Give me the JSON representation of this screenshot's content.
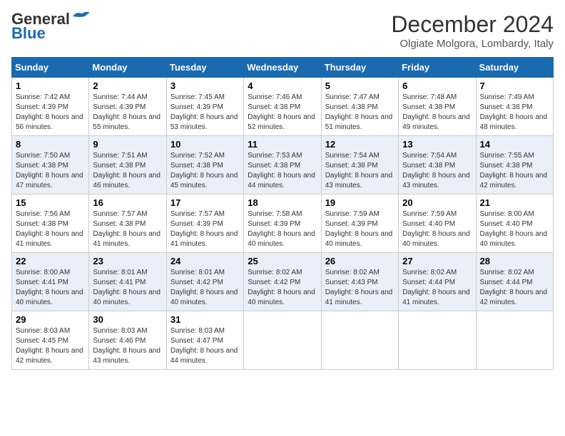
{
  "header": {
    "logo_line1": "General",
    "logo_line2": "Blue",
    "month_title": "December 2024",
    "location": "Olgiate Molgora, Lombardy, Italy"
  },
  "weekdays": [
    "Sunday",
    "Monday",
    "Tuesday",
    "Wednesday",
    "Thursday",
    "Friday",
    "Saturday"
  ],
  "weeks": [
    [
      {
        "day": "1",
        "sunrise": "7:42 AM",
        "sunset": "4:39 PM",
        "daylight": "8 hours and 56 minutes."
      },
      {
        "day": "2",
        "sunrise": "7:44 AM",
        "sunset": "4:39 PM",
        "daylight": "8 hours and 55 minutes."
      },
      {
        "day": "3",
        "sunrise": "7:45 AM",
        "sunset": "4:39 PM",
        "daylight": "8 hours and 53 minutes."
      },
      {
        "day": "4",
        "sunrise": "7:46 AM",
        "sunset": "4:38 PM",
        "daylight": "8 hours and 52 minutes."
      },
      {
        "day": "5",
        "sunrise": "7:47 AM",
        "sunset": "4:38 PM",
        "daylight": "8 hours and 51 minutes."
      },
      {
        "day": "6",
        "sunrise": "7:48 AM",
        "sunset": "4:38 PM",
        "daylight": "8 hours and 49 minutes."
      },
      {
        "day": "7",
        "sunrise": "7:49 AM",
        "sunset": "4:38 PM",
        "daylight": "8 hours and 48 minutes."
      }
    ],
    [
      {
        "day": "8",
        "sunrise": "7:50 AM",
        "sunset": "4:38 PM",
        "daylight": "8 hours and 47 minutes."
      },
      {
        "day": "9",
        "sunrise": "7:51 AM",
        "sunset": "4:38 PM",
        "daylight": "8 hours and 46 minutes."
      },
      {
        "day": "10",
        "sunrise": "7:52 AM",
        "sunset": "4:38 PM",
        "daylight": "8 hours and 45 minutes."
      },
      {
        "day": "11",
        "sunrise": "7:53 AM",
        "sunset": "4:38 PM",
        "daylight": "8 hours and 44 minutes."
      },
      {
        "day": "12",
        "sunrise": "7:54 AM",
        "sunset": "4:38 PM",
        "daylight": "8 hours and 43 minutes."
      },
      {
        "day": "13",
        "sunrise": "7:54 AM",
        "sunset": "4:38 PM",
        "daylight": "8 hours and 43 minutes."
      },
      {
        "day": "14",
        "sunrise": "7:55 AM",
        "sunset": "4:38 PM",
        "daylight": "8 hours and 42 minutes."
      }
    ],
    [
      {
        "day": "15",
        "sunrise": "7:56 AM",
        "sunset": "4:38 PM",
        "daylight": "8 hours and 41 minutes."
      },
      {
        "day": "16",
        "sunrise": "7:57 AM",
        "sunset": "4:38 PM",
        "daylight": "8 hours and 41 minutes."
      },
      {
        "day": "17",
        "sunrise": "7:57 AM",
        "sunset": "4:39 PM",
        "daylight": "8 hours and 41 minutes."
      },
      {
        "day": "18",
        "sunrise": "7:58 AM",
        "sunset": "4:39 PM",
        "daylight": "8 hours and 40 minutes."
      },
      {
        "day": "19",
        "sunrise": "7:59 AM",
        "sunset": "4:39 PM",
        "daylight": "8 hours and 40 minutes."
      },
      {
        "day": "20",
        "sunrise": "7:59 AM",
        "sunset": "4:40 PM",
        "daylight": "8 hours and 40 minutes."
      },
      {
        "day": "21",
        "sunrise": "8:00 AM",
        "sunset": "4:40 PM",
        "daylight": "8 hours and 40 minutes."
      }
    ],
    [
      {
        "day": "22",
        "sunrise": "8:00 AM",
        "sunset": "4:41 PM",
        "daylight": "8 hours and 40 minutes."
      },
      {
        "day": "23",
        "sunrise": "8:01 AM",
        "sunset": "4:41 PM",
        "daylight": "8 hours and 40 minutes."
      },
      {
        "day": "24",
        "sunrise": "8:01 AM",
        "sunset": "4:42 PM",
        "daylight": "8 hours and 40 minutes."
      },
      {
        "day": "25",
        "sunrise": "8:02 AM",
        "sunset": "4:42 PM",
        "daylight": "8 hours and 40 minutes."
      },
      {
        "day": "26",
        "sunrise": "8:02 AM",
        "sunset": "4:43 PM",
        "daylight": "8 hours and 41 minutes."
      },
      {
        "day": "27",
        "sunrise": "8:02 AM",
        "sunset": "4:44 PM",
        "daylight": "8 hours and 41 minutes."
      },
      {
        "day": "28",
        "sunrise": "8:02 AM",
        "sunset": "4:44 PM",
        "daylight": "8 hours and 42 minutes."
      }
    ],
    [
      {
        "day": "29",
        "sunrise": "8:03 AM",
        "sunset": "4:45 PM",
        "daylight": "8 hours and 42 minutes."
      },
      {
        "day": "30",
        "sunrise": "8:03 AM",
        "sunset": "4:46 PM",
        "daylight": "8 hours and 43 minutes."
      },
      {
        "day": "31",
        "sunrise": "8:03 AM",
        "sunset": "4:47 PM",
        "daylight": "8 hours and 44 minutes."
      },
      null,
      null,
      null,
      null
    ]
  ]
}
